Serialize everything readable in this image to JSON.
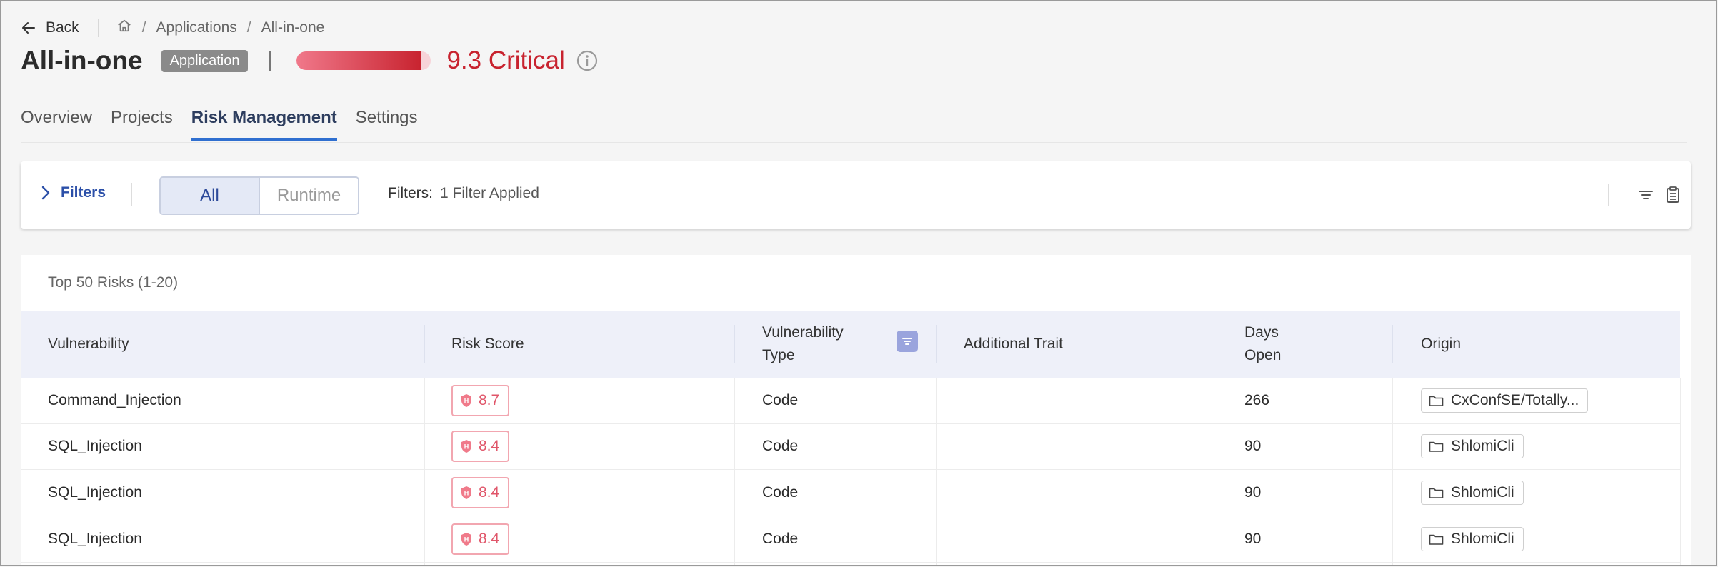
{
  "header": {
    "back_label": "Back",
    "breadcrumb": [
      "Applications",
      "All-in-one"
    ],
    "title": "All-in-one",
    "type_badge": "Application",
    "risk_score": 9.3,
    "risk_label": "9.3 Critical"
  },
  "tabs": [
    {
      "label": "Overview"
    },
    {
      "label": "Projects"
    },
    {
      "label": "Risk Management"
    },
    {
      "label": "Settings"
    }
  ],
  "active_tab": "Risk Management",
  "filters": {
    "toggle_label": "Filters",
    "segments": [
      "All",
      "Runtime"
    ],
    "selected_segment": "All",
    "applied_label": "Filters:",
    "applied_value": "1 Filter Applied"
  },
  "table": {
    "title": "Top 50 Risks (1-20)",
    "columns": {
      "vulnerability": "Vulnerability",
      "risk_score": "Risk Score",
      "type_line1": "Vulnerability",
      "type_line2": "Type",
      "trait": "Additional Trait",
      "days_line1": "Days",
      "days_line2": "Open",
      "origin": "Origin"
    },
    "rows": [
      {
        "vulnerability": "Command_Injection",
        "score": "8.7",
        "severity": "H",
        "type": "Code",
        "trait": "",
        "days": "266",
        "origin": "CxConfSE/Totally..."
      },
      {
        "vulnerability": "SQL_Injection",
        "score": "8.4",
        "severity": "H",
        "type": "Code",
        "trait": "",
        "days": "90",
        "origin": "ShlomiCli"
      },
      {
        "vulnerability": "SQL_Injection",
        "score": "8.4",
        "severity": "H",
        "type": "Code",
        "trait": "",
        "days": "90",
        "origin": "ShlomiCli"
      },
      {
        "vulnerability": "SQL_Injection",
        "score": "8.4",
        "severity": "H",
        "type": "Code",
        "trait": "",
        "days": "90",
        "origin": "ShlomiCli"
      }
    ]
  },
  "colors": {
    "critical": "#c8232f",
    "accent": "#2f6fd0",
    "score_text": "#e0566a"
  }
}
